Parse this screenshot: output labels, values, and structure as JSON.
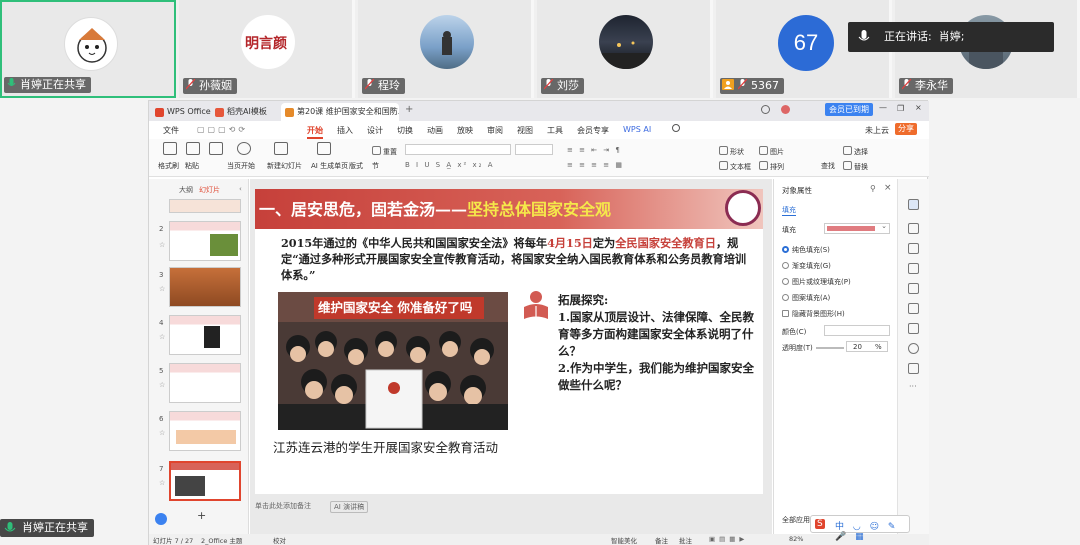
{
  "participants": [
    {
      "name": "肖婷正在共享",
      "active": true
    },
    {
      "name": "孙薇姻"
    },
    {
      "name": "程玲"
    },
    {
      "name": "刘莎"
    },
    {
      "name": "5367",
      "avatar_text": "67"
    },
    {
      "name": "李永华"
    }
  ],
  "speaking": {
    "label": "正在讲话:",
    "speaker": "肖婷;"
  },
  "bottom_share": "肖婷正在共享",
  "wps": {
    "tabs": [
      "WPS Office",
      "稻壳AI模板",
      "第20课 维护国家安全和国防..."
    ],
    "menus": [
      "文件",
      "开始",
      "插入",
      "设计",
      "切换",
      "动画",
      "放映",
      "审阅",
      "视图",
      "工具",
      "会员专享",
      "WPS AI"
    ],
    "account": "会员已到期",
    "cloud_label": "未上云",
    "share_label": "分享",
    "ribbon": {
      "format_brush": "格式刷",
      "paste": "粘贴",
      "current_start": "当页开始",
      "new_slide": "新建幻灯片",
      "ai_slide": "AI 生成单页",
      "layout": "版式",
      "section": "节",
      "reset": "重置",
      "shape": "形状",
      "textbox": "文本框",
      "picture": "图片",
      "arrange": "排列",
      "find": "查找",
      "select": "选择",
      "replace": "替换"
    },
    "pane_tabs": [
      "大纲",
      "幻灯片"
    ],
    "thumb_numbers": [
      "2",
      "3",
      "4",
      "5",
      "6",
      "7"
    ],
    "notes_hint": "单击此处添加备注",
    "ai_speech": "AI 演讲稿",
    "status": {
      "slide": "幻灯片 7 / 27",
      "theme": "2_Office 主题",
      "check": "校对",
      "beautify": "智能美化",
      "notes": "备注",
      "comments": "批注",
      "zoom": "82%"
    }
  },
  "slide": {
    "banner_left": "一、居安思危，固若金汤——",
    "banner_right": "坚持总体国家安全观",
    "para_1": "2015年通过的《中华人民共和国国家安全法》将每年",
    "para_date": "4月15日",
    "para_2": "定为",
    "para_red": "全民国家安全教育日",
    "para_3": "，规定“通过多种形式开展国家安全宣传教育活动，将国家安全纳入国民教育体系和公务员教育培训体系。”",
    "photo_sign": "维护国家安全 你准备好了吗",
    "caption": "江苏连云港的学生开展国家安全教育活动",
    "explore_title": "拓展探究:",
    "explore_1": "1.国家从顶层设计、法律保障、全民教育等多方面构建国家安全体系说明了什么？",
    "explore_2": "2.作为中学生，我们能为维护国家安全做些什么呢？"
  },
  "properties": {
    "title": "对象属性",
    "section": "填充",
    "fill_label": "填充",
    "options": [
      "纯色填充(S)",
      "渐变填充(G)",
      "图片或纹理填充(P)",
      "图案填充(A)",
      "隐藏背景图形(H)"
    ],
    "color_label": "颜色(C)",
    "transparency_label": "透明度(T)",
    "transparency_value": "20",
    "transparency_unit": "%",
    "apply_all": "全部应用",
    "fill_color": "#e07c80"
  }
}
